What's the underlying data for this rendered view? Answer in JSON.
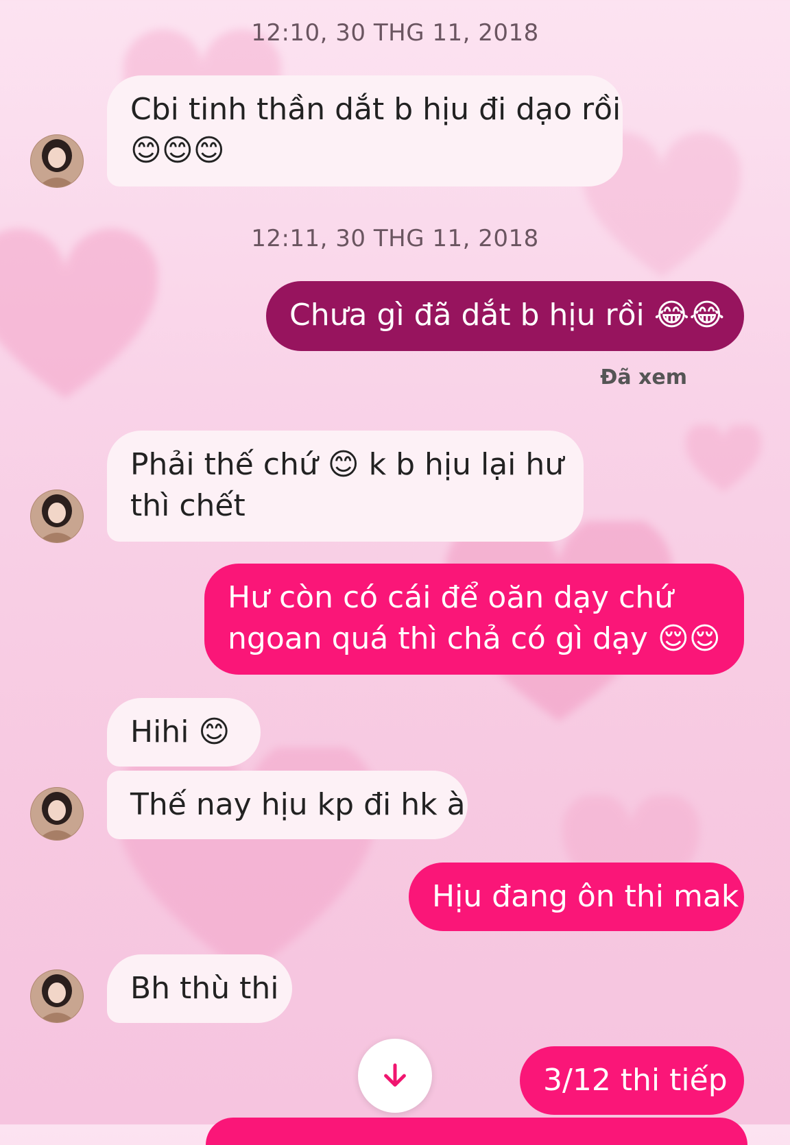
{
  "thread": {
    "messages": [
      {
        "kind": "timestamp",
        "text": "12:10, 30 THG 11, 2018"
      },
      {
        "kind": "incoming",
        "lines": [
          "Cbi tinh thần dắt b hịu đi dạo rồi",
          "😊😊😊"
        ]
      },
      {
        "kind": "timestamp",
        "text": "12:11, 30 THG 11, 2018"
      },
      {
        "kind": "outgoing",
        "lines": [
          "Chưa gì đã dắt b hịu rồi 😂😂"
        ]
      },
      {
        "kind": "incoming",
        "lines": [
          "Phải thế chứ 😊 k b hịu lại hư",
          "thì chết"
        ]
      },
      {
        "kind": "outgoing",
        "lines": [
          "Hư còn có cái để oăn dạy chứ",
          "ngoan quá thì chả có gì dạy 😌😌"
        ]
      },
      {
        "kind": "incoming",
        "lines": [
          "Hihi 😊"
        ]
      },
      {
        "kind": "incoming",
        "lines": [
          "Thế nay hịu kp đi hk à"
        ]
      },
      {
        "kind": "outgoing",
        "lines": [
          "Hịu đang ôn thi mak"
        ]
      },
      {
        "kind": "incoming",
        "lines": [
          "Bh thù thi"
        ]
      },
      {
        "kind": "outgoing",
        "lines": [
          "3/12  thi tiếp"
        ]
      }
    ],
    "seen_label": "Đã xem"
  },
  "icons": {
    "scroll_down": "arrow-down-icon",
    "avatar": "contact-avatar"
  },
  "colors": {
    "background": "#f9d3e8",
    "incoming_bubble": "#fdf1f6",
    "outgoing_dark": "#97145e",
    "outgoing_pink": "#fa1678",
    "timestamp_text": "#6a5560"
  }
}
